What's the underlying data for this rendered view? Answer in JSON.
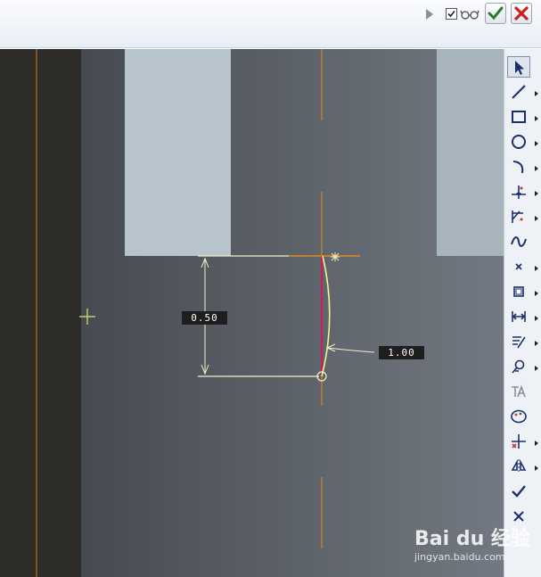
{
  "toolbar": {
    "icons": [
      "play-arrow-icon",
      "checkbox-icon",
      "glasses-icon",
      "checkmark-icon",
      "close-x-icon"
    ],
    "ok_color": "#2b7a2b",
    "cancel_color": "#cc1f1f"
  },
  "sketch": {
    "dimension_height": "0.50",
    "dimension_radius": "1.00",
    "curve_color": "#f2f28c",
    "centerline_color": "#e08a1e",
    "highlight_color": "#d4185c"
  },
  "palette": {
    "tools": [
      {
        "name": "select-arrow-icon",
        "selected": true,
        "flyout": false
      },
      {
        "name": "line-icon",
        "flyout": true
      },
      {
        "name": "rectangle-icon",
        "flyout": true
      },
      {
        "name": "circle-icon",
        "flyout": true
      },
      {
        "name": "arc-icon",
        "flyout": true
      },
      {
        "name": "fillet-icon",
        "flyout": true
      },
      {
        "name": "chamfer-icon",
        "flyout": true
      },
      {
        "name": "spline-icon",
        "flyout": false
      },
      {
        "name": "point-icon",
        "flyout": true
      },
      {
        "name": "offset-edge-icon",
        "flyout": true
      },
      {
        "name": "dimension-icon",
        "flyout": true
      },
      {
        "name": "modify-icon",
        "flyout": true
      },
      {
        "name": "constraint-icon",
        "flyout": true
      },
      {
        "name": "text-icon",
        "flyout": false
      },
      {
        "name": "palette-icon",
        "flyout": false
      },
      {
        "name": "trim-icon",
        "flyout": true
      },
      {
        "name": "mirror-icon",
        "flyout": true
      },
      {
        "name": "done-check-icon",
        "flyout": false
      },
      {
        "name": "quit-x-icon",
        "flyout": false
      }
    ]
  },
  "watermark": {
    "logo": "Bai du 经验",
    "url": "jingyan.baidu.com"
  }
}
